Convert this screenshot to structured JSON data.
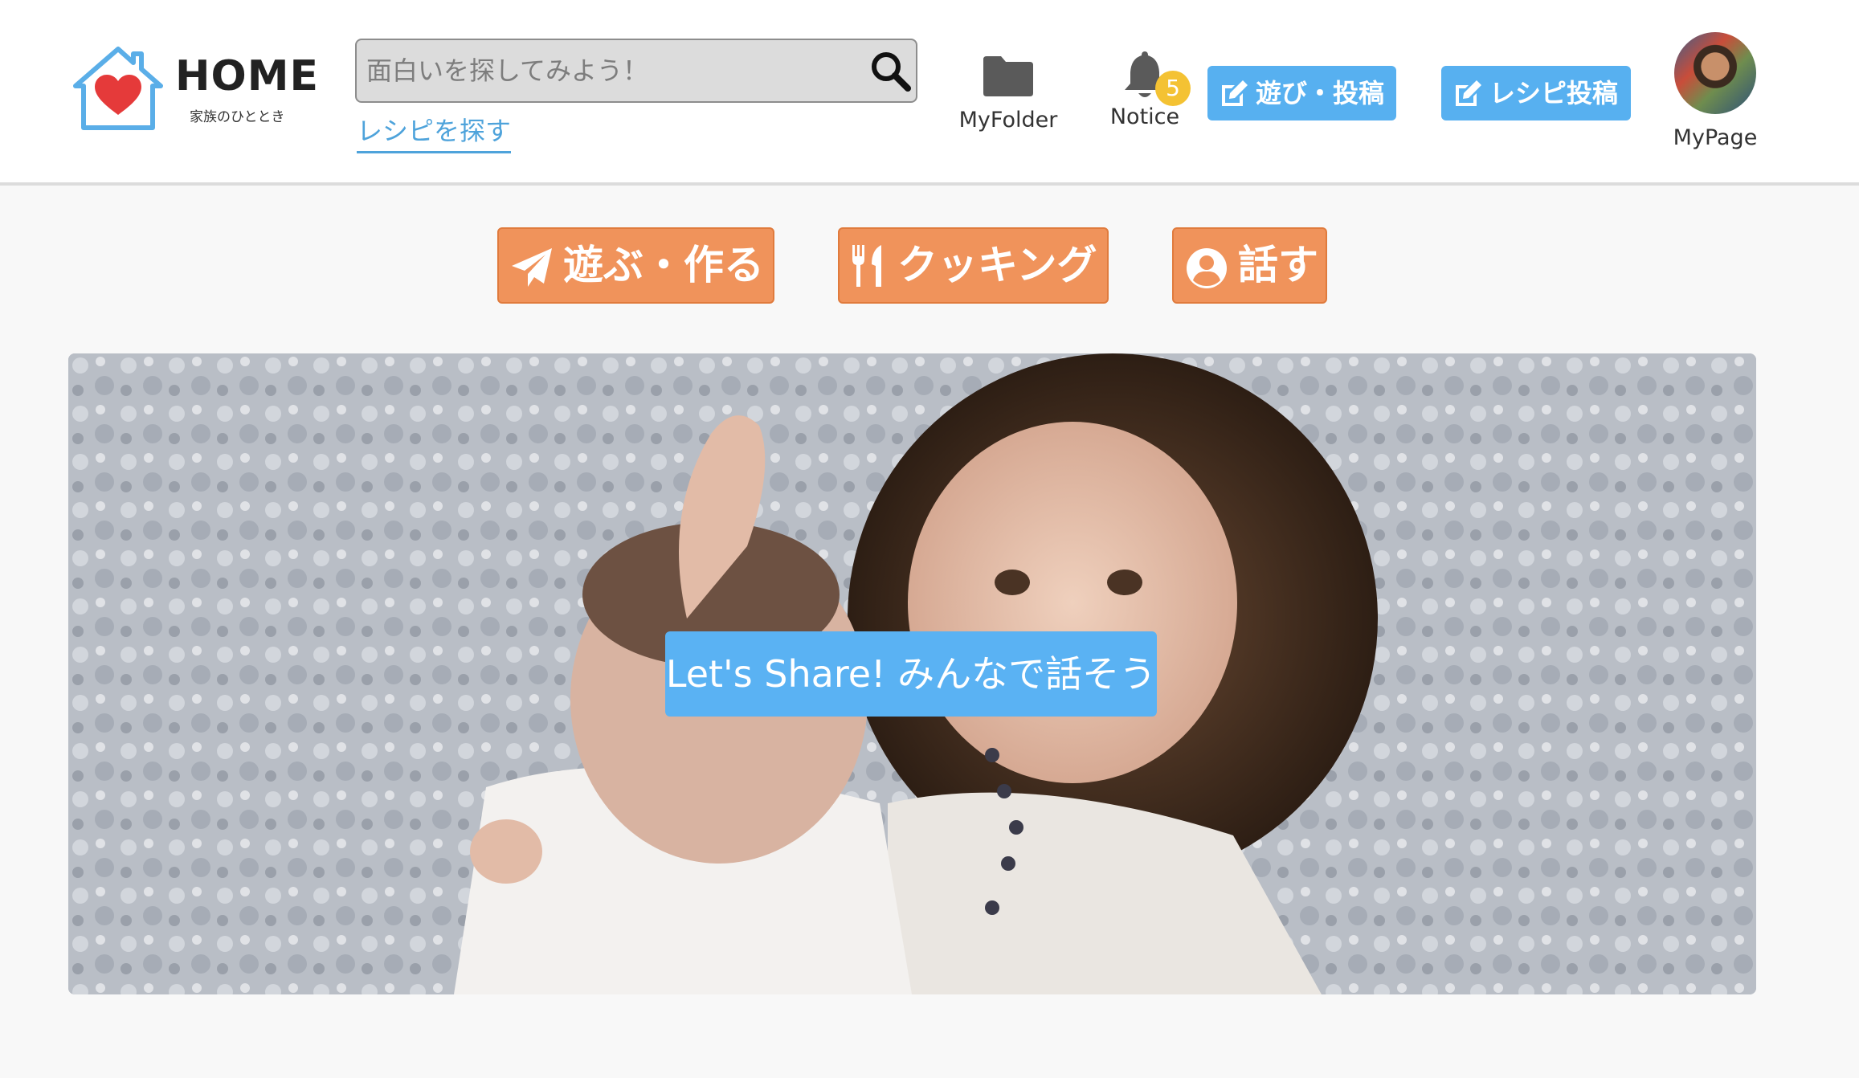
{
  "header": {
    "logo": {
      "title": "HOME",
      "subtitle": "家族のひととき",
      "icon": "house-heart-icon",
      "heart_color": "#e53a3a",
      "house_color": "#5aaee8"
    },
    "search": {
      "placeholder": "面白いを探してみよう！",
      "icon": "search-icon"
    },
    "recipe_link": "レシピを探す",
    "nav": {
      "folder_label": "MyFolder",
      "notice_label": "Notice",
      "notice_count": "5",
      "mypage_label": "MyPage"
    },
    "post_buttons": {
      "play_post": "遊び・投稿",
      "recipe_post": "レシピ投稿"
    }
  },
  "categories": {
    "play": "遊ぶ・作る",
    "cooking": "クッキング",
    "talk": "話す"
  },
  "hero": {
    "caption": "Let's Share! みんなで話そう"
  },
  "colors": {
    "accent_blue": "#57b0f0",
    "accent_orange": "#f0935b",
    "badge_yellow": "#f4c233",
    "link_blue": "#4ea3db"
  }
}
